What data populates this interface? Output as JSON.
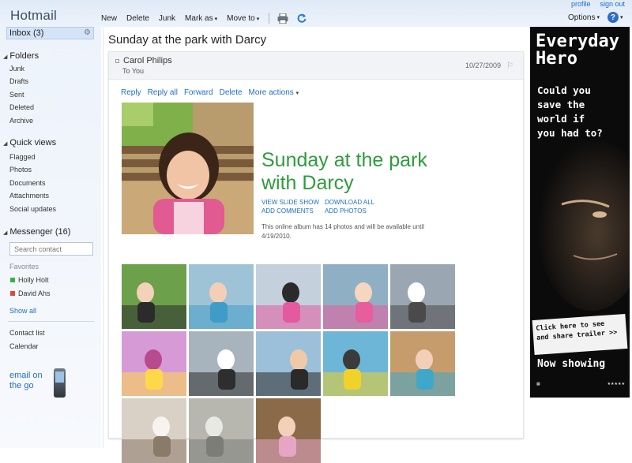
{
  "header": {
    "brand": "Hotmail",
    "toolbar": [
      {
        "label": "New",
        "dropdown": false
      },
      {
        "label": "Delete",
        "dropdown": false
      },
      {
        "label": "Junk",
        "dropdown": false
      },
      {
        "label": "Mark as",
        "dropdown": true
      },
      {
        "label": "Move to",
        "dropdown": true
      }
    ],
    "caret": "▾",
    "top_links": {
      "profile": "profile",
      "sign_out": "sign out"
    },
    "options": "Options",
    "help_glyph": "?"
  },
  "sidebar": {
    "inbox": "Inbox (3)",
    "folders_heading": "Folders",
    "folders": [
      "Junk",
      "Drafts",
      "Sent",
      "Deleted",
      "Archive"
    ],
    "quick_views_heading": "Quick views",
    "quick_views": [
      "Flagged",
      "Photos",
      "Documents",
      "Attachments",
      "Social updates"
    ],
    "messenger_heading": "Messenger (16)",
    "search_placeholder": "Search contact",
    "favorites_label": "Favorites",
    "contacts": [
      {
        "name": "Holly Holt",
        "status_color": "#3cb043"
      },
      {
        "name": "David Ahs",
        "status_color": "#e0473a"
      }
    ],
    "show_all": "Show all",
    "contact_list": "Contact list",
    "calendar": "Calendar",
    "email_go": [
      "email on",
      "the go"
    ]
  },
  "message": {
    "subject": "Sunday at the park with Darcy",
    "sender": "Carol Philips",
    "recipient": "To You",
    "date": "10/27/2009",
    "actions": [
      "Reply",
      "Reply all",
      "Forward",
      "Delete",
      "More actions"
    ],
    "album_title": "Sunday at the park with Darcy",
    "album_links": [
      "VIEW SLIDE SHOW",
      "DOWNLOAD ALL",
      "ADD COMMENTS",
      "ADD PHOTOS"
    ],
    "album_description": "This online album has 14 photos and will be available until 4/19/2010.",
    "photo_count": 14
  },
  "ad": {
    "headline": [
      "Everyday",
      "Hero"
    ],
    "question": [
      "Could you",
      "save the",
      "world if",
      "you had to?"
    ],
    "cta": [
      "Click here to see",
      "and share trailer >>"
    ],
    "now_showing": "Now showing"
  },
  "colors": {
    "link": "#1f6fc5",
    "album_title": "#2e9c3c",
    "brand": "#3d4f66"
  }
}
